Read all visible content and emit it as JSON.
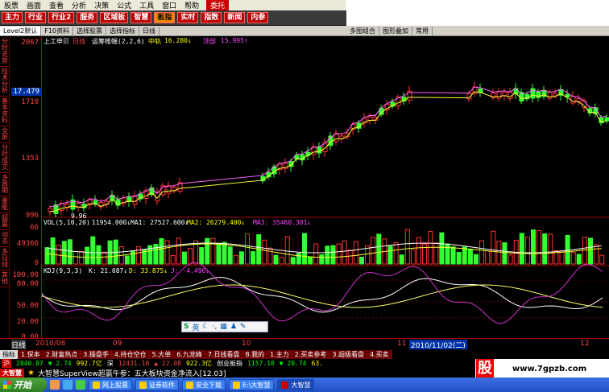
{
  "menu": [
    "股票",
    "画面",
    "查看",
    "分析",
    "决策",
    "公式",
    "工具",
    "窗口",
    "帮助",
    "委托"
  ],
  "toolbar": [
    "主力",
    "行业",
    "行业2",
    "服务",
    "区域板",
    "智慧",
    "板指",
    "实时",
    "指数",
    "新闻",
    "内参"
  ],
  "tabs_left": [
    "Level2默认",
    "F10资料",
    "选择股票",
    "选择指标",
    "日线",
    "多图组合",
    "图形叠加",
    "常用"
  ],
  "sidebar": [
    "分时走势",
    "技术分析",
    "基本资料",
    "全屏",
    "分时成交",
    "多周期",
    "量能",
    "超赢",
    "动态",
    "多日线",
    "其他"
  ],
  "price_panel": {
    "title": "上工申贝",
    "period": "日线",
    "indicator": "运筹帷幄(2,2,6)",
    "mid_label": "中轨",
    "mid_value": "16.280↓",
    "upper_label": "顶部",
    "upper_value": "15.995↑",
    "current_value": "17.479",
    "low_label": "9.96",
    "y_ticks": [
      "2067",
      "1710",
      "1353",
      "996"
    ]
  },
  "vol_panel": {
    "title": "VOL(5,10,20)",
    "v": "11954.000↓",
    "ma1": "MA1: 27527.600↓",
    "ma2": "MA2: 26279.400↓",
    "ma3": "MA3: 35460.301↓",
    "y_ticks": [
      "66",
      "49366",
      "0"
    ]
  },
  "kdj_panel": {
    "title": "KDJ(9,3,3)",
    "k": "K: 21.087↓",
    "d": "D: 33.875↓",
    "j": "J: -4.490↓",
    "y_ticks": [
      "100.00",
      "80.00",
      "50.00",
      "20.00",
      "0.00"
    ]
  },
  "time_axis": [
    "2010/08",
    "09",
    "10",
    "11",
    "2010/11/02(二)",
    "12"
  ],
  "bottom_tabs": [
    "指标",
    "1.保本",
    "2.财富热点",
    "3.操盘手",
    "4.持仓空仓",
    "5.大单",
    "6.九龙峰",
    "7.日线看盘",
    "8.我的",
    "1.主力",
    "2.买卖参考",
    "3.超级看盘",
    "4.买卖"
  ],
  "quote": {
    "label1": "沪",
    "v1": "2840.87",
    "c1": "▼ 2.74",
    "v2": "992.7亿",
    "label2": "深",
    "v3": "12431.10",
    "c2": "▲ 22.08",
    "v4": "922.3亿",
    "label3": "创业板指",
    "v5": "1157.10",
    "c3": "▼ 20.74",
    "v6": "63."
  },
  "ticker": {
    "logo": "大智慧",
    "text": "大智慧SuperView超赢午参：五大板块资金净流入[12.03]"
  },
  "ime": {
    "lang": "英"
  },
  "promo": {
    "big": "股",
    "site": "www.7gpzb.com"
  },
  "taskbar": {
    "start": "开始",
    "tasks": [
      "网上股票",
      "证券软件",
      "安全下载",
      "E:\\大智慧",
      "大智慧"
    ]
  },
  "chart_data": [
    {
      "type": "candlestick",
      "title": "上工申贝 日线",
      "ylim": [
        996,
        2067
      ],
      "up_color": "#ff3333",
      "down_color": "#33ff33"
    },
    {
      "type": "bar",
      "title": "VOL(5,10,20)",
      "series": [
        {
          "name": "MA1"
        },
        {
          "name": "MA2"
        },
        {
          "name": "MA3"
        }
      ]
    },
    {
      "type": "line",
      "title": "KDJ(9,3,3)",
      "ylim": [
        0,
        100
      ],
      "series": [
        {
          "name": "K",
          "color": "#ffffff"
        },
        {
          "name": "D",
          "color": "#ffff66"
        },
        {
          "name": "J",
          "color": "#cc33cc"
        }
      ]
    }
  ]
}
